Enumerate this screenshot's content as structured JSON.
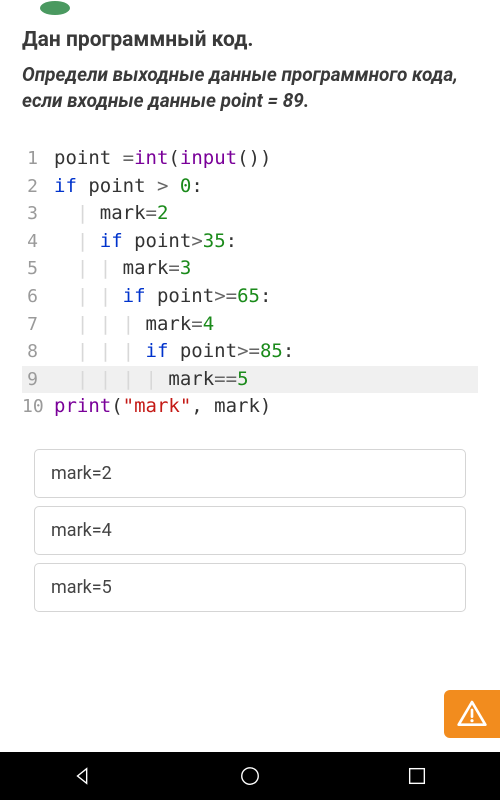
{
  "header": {
    "logo_text": ""
  },
  "question": {
    "heading": "Дан программный код.",
    "subheading": "Определи выходные данные программного кода, если входные данные point = 89."
  },
  "code": {
    "lines": [
      {
        "num": "1",
        "indent": "",
        "tokens": [
          {
            "t": "txt",
            "v": "point "
          },
          {
            "t": "op",
            "v": "="
          },
          {
            "t": "fn",
            "v": "int"
          },
          {
            "t": "txt",
            "v": "("
          },
          {
            "t": "fn",
            "v": "input"
          },
          {
            "t": "txt",
            "v": "())"
          }
        ]
      },
      {
        "num": "2",
        "indent": "",
        "tokens": [
          {
            "t": "kw",
            "v": "if"
          },
          {
            "t": "txt",
            "v": " point "
          },
          {
            "t": "op",
            "v": ">"
          },
          {
            "t": "txt",
            "v": " "
          },
          {
            "t": "num",
            "v": "0"
          },
          {
            "t": "txt",
            "v": ":"
          }
        ]
      },
      {
        "num": "3",
        "indent": "  ",
        "guides": "| ",
        "tokens": [
          {
            "t": "txt",
            "v": "mark"
          },
          {
            "t": "op",
            "v": "="
          },
          {
            "t": "num",
            "v": "2"
          }
        ]
      },
      {
        "num": "4",
        "indent": "  ",
        "guides": "| ",
        "tokens": [
          {
            "t": "kw",
            "v": "if"
          },
          {
            "t": "txt",
            "v": " point"
          },
          {
            "t": "op",
            "v": ">"
          },
          {
            "t": "num",
            "v": "35"
          },
          {
            "t": "txt",
            "v": ":"
          }
        ]
      },
      {
        "num": "5",
        "indent": "  ",
        "guides": "| | ",
        "tokens": [
          {
            "t": "txt",
            "v": "mark"
          },
          {
            "t": "op",
            "v": "="
          },
          {
            "t": "num",
            "v": "3"
          }
        ]
      },
      {
        "num": "6",
        "indent": "  ",
        "guides": "| | ",
        "tokens": [
          {
            "t": "kw",
            "v": "if"
          },
          {
            "t": "txt",
            "v": " point"
          },
          {
            "t": "op",
            "v": ">="
          },
          {
            "t": "num",
            "v": "65"
          },
          {
            "t": "txt",
            "v": ":"
          }
        ]
      },
      {
        "num": "7",
        "indent": "  ",
        "guides": "| | | ",
        "tokens": [
          {
            "t": "txt",
            "v": "mark"
          },
          {
            "t": "op",
            "v": "="
          },
          {
            "t": "num",
            "v": "4"
          }
        ]
      },
      {
        "num": "8",
        "indent": "  ",
        "guides": "| | | ",
        "tokens": [
          {
            "t": "kw",
            "v": "if"
          },
          {
            "t": "txt",
            "v": " point"
          },
          {
            "t": "op",
            "v": ">="
          },
          {
            "t": "num",
            "v": "85"
          },
          {
            "t": "txt",
            "v": ":"
          }
        ]
      },
      {
        "num": "9",
        "indent": "  ",
        "guides": "| | | | ",
        "highlight": true,
        "tokens": [
          {
            "t": "txt",
            "v": "mark"
          },
          {
            "t": "op",
            "v": "=="
          },
          {
            "t": "num",
            "v": "5"
          }
        ]
      },
      {
        "num": "10",
        "indent": "",
        "tokens": [
          {
            "t": "fn",
            "v": "print"
          },
          {
            "t": "txt",
            "v": "("
          },
          {
            "t": "str",
            "v": "\"mark\""
          },
          {
            "t": "txt",
            "v": ", mark)"
          }
        ]
      }
    ]
  },
  "answers": [
    {
      "label": "mark=2"
    },
    {
      "label": "mark=4"
    },
    {
      "label": "mark=5"
    }
  ],
  "nav": {
    "back": "back-button",
    "home": "home-button",
    "recent": "recent-button"
  }
}
